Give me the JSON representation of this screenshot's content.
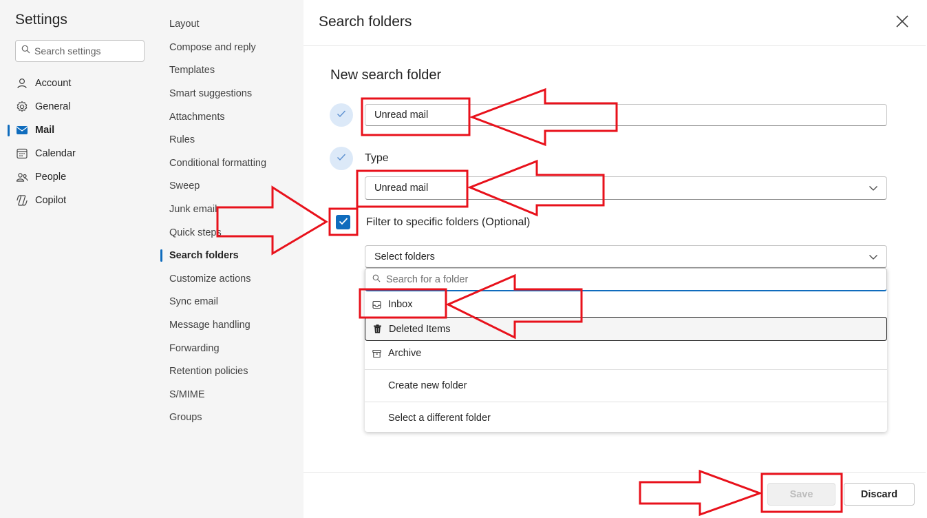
{
  "settings": {
    "title": "Settings",
    "search_placeholder": "Search settings",
    "nav": [
      {
        "label": "Account",
        "icon": "person-icon"
      },
      {
        "label": "General",
        "icon": "gear-icon"
      },
      {
        "label": "Mail",
        "icon": "mail-icon",
        "active": true
      },
      {
        "label": "Calendar",
        "icon": "calendar-icon"
      },
      {
        "label": "People",
        "icon": "people-icon"
      },
      {
        "label": "Copilot",
        "icon": "copilot-icon"
      }
    ]
  },
  "mail_settings": {
    "items": [
      "Layout",
      "Compose and reply",
      "Templates",
      "Smart suggestions",
      "Attachments",
      "Rules",
      "Conditional formatting",
      "Sweep",
      "Junk email",
      "Quick steps",
      "Search folders",
      "Customize actions",
      "Sync email",
      "Message handling",
      "Forwarding",
      "Retention policies",
      "S/MIME",
      "Groups"
    ],
    "active": "Search folders"
  },
  "panel": {
    "title": "Search folders",
    "section_title": "New search folder",
    "name_value": "Unread mail",
    "type_label": "Type",
    "type_value": "Unread mail",
    "filter_label": "Filter to specific folders (Optional)",
    "filter_checked": true,
    "folders_placeholder": "Select folders",
    "folder_search_placeholder": "Search for a folder",
    "folder_options": [
      {
        "label": "Inbox",
        "icon": "inbox-icon"
      },
      {
        "label": "Deleted Items",
        "icon": "trash-icon"
      },
      {
        "label": "Archive",
        "icon": "archive-icon"
      }
    ],
    "create_new_folder": "Create new folder",
    "select_different_folder": "Select a different folder",
    "save_label": "Save",
    "discard_label": "Discard"
  },
  "colors": {
    "accent": "#0f6cbd",
    "annotation": "#e8111b",
    "sidebar_bg": "#f5f5f5"
  }
}
